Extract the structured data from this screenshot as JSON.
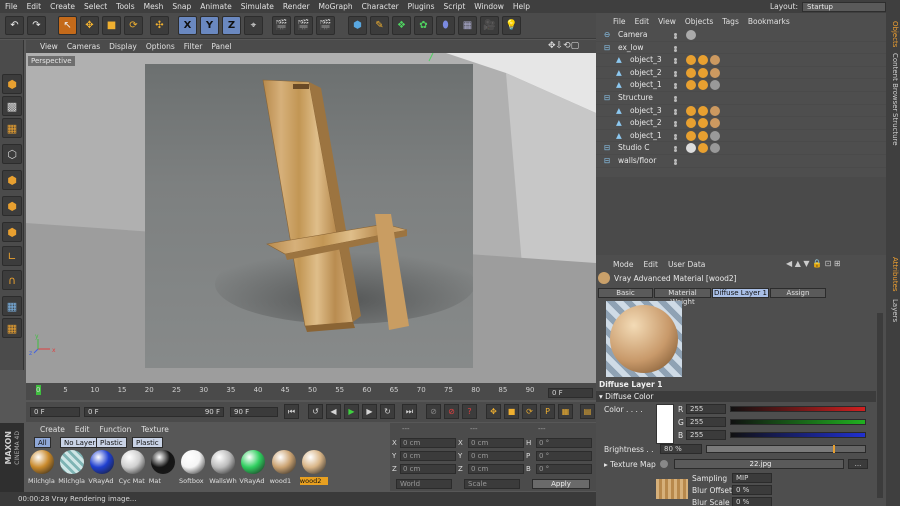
{
  "menubar": {
    "items": [
      "File",
      "Edit",
      "Create",
      "Select",
      "Tools",
      "Mesh",
      "Snap",
      "Animate",
      "Simulate",
      "Render",
      "MoGraph",
      "Character",
      "Plugins",
      "Script",
      "Window",
      "Help"
    ]
  },
  "layout": {
    "label": "Layout:",
    "value": "Startup"
  },
  "viewport": {
    "menu": [
      "View",
      "Cameras",
      "Display",
      "Options",
      "Filter",
      "Panel"
    ],
    "label": "Perspective"
  },
  "timeline": {
    "ticks": [
      "0",
      "5",
      "10",
      "15",
      "20",
      "25",
      "30",
      "35",
      "40",
      "45",
      "50",
      "55",
      "60",
      "65",
      "70",
      "75",
      "80",
      "85",
      "90"
    ],
    "end_field": "0 F",
    "current_frame": 0
  },
  "playback": {
    "start": "0 F",
    "min": "0 F",
    "max": "90 F",
    "end": "90 F"
  },
  "materials": {
    "menu": [
      "Create",
      "Edit",
      "Function",
      "Texture"
    ],
    "filters": [
      "All",
      "No Layer",
      "Plastic",
      "Plastic"
    ],
    "items": [
      {
        "name": "Milchgla",
        "color": "#c98a2c"
      },
      {
        "name": "Milchgla",
        "color": "#9fc9c9"
      },
      {
        "name": "VRayAd",
        "color": "#1f3fd0"
      },
      {
        "name": "Cyc Mat",
        "color": "#d0d0d0"
      },
      {
        "name": "Mat",
        "color": "#151515"
      },
      {
        "name": "Softbox",
        "color": "#f4f4f4"
      },
      {
        "name": "WallsWh",
        "color": "#bdbdbd"
      },
      {
        "name": "VRayAd",
        "color": "#2fcf5f"
      },
      {
        "name": "wood1",
        "color": "#cba372"
      },
      {
        "name": "wood2",
        "color": "#d9b587"
      }
    ]
  },
  "coords": {
    "headers": [
      "---",
      "---",
      "---"
    ],
    "rows": [
      {
        "a": "X",
        "av": "0 cm",
        "b": "X",
        "bv": "0 cm",
        "c": "H",
        "cv": "0 °"
      },
      {
        "a": "Y",
        "av": "0 cm",
        "b": "Y",
        "bv": "0 cm",
        "c": "P",
        "cv": "0 °"
      },
      {
        "a": "Z",
        "av": "0 cm",
        "b": "Z",
        "bv": "0 cm",
        "c": "B",
        "cv": "0 °"
      }
    ],
    "world": "World",
    "scale": "Scale",
    "apply": "Apply"
  },
  "status": {
    "text": "00:00:28 Vray Rendering image..."
  },
  "maxon": {
    "line1": "MAXON",
    "line2": "CINEMA 4D"
  },
  "objects": {
    "menu": [
      "File",
      "Edit",
      "View",
      "Objects",
      "Tags",
      "Bookmarks"
    ],
    "rows": [
      {
        "name": "Camera",
        "indent": 0
      },
      {
        "name": "ex_low",
        "indent": 0
      },
      {
        "name": "object_3",
        "indent": 1
      },
      {
        "name": "object_2",
        "indent": 1
      },
      {
        "name": "object_1",
        "indent": 1
      },
      {
        "name": "Structure",
        "indent": 0
      },
      {
        "name": "object_3",
        "indent": 1
      },
      {
        "name": "object_2",
        "indent": 1
      },
      {
        "name": "object_1",
        "indent": 1
      },
      {
        "name": "Studio C",
        "indent": 0
      },
      {
        "name": "walls/floor",
        "indent": 0
      }
    ]
  },
  "attributes": {
    "menu": [
      "Mode",
      "Edit",
      "User Data"
    ],
    "material_title": "Vray Advanced Material [wood2]",
    "tabs": [
      "Basic",
      "Material Weight",
      "Diffuse Layer 1",
      "Assign"
    ],
    "active_tab": "Diffuse Layer 1",
    "section_title": "Diffuse Layer 1",
    "subsection": "Diffuse Color",
    "color_label": "Color . . . .",
    "rgb": [
      {
        "ch": "R",
        "val": "255",
        "color": "#d02020"
      },
      {
        "ch": "G",
        "val": "255",
        "color": "#20b020"
      },
      {
        "ch": "B",
        "val": "255",
        "color": "#2030d0"
      }
    ],
    "brightness_label": "Brightness . .",
    "brightness_value": "80 %",
    "brightness_level": 0.8,
    "texture_label": "Texture Map",
    "texture_file": "22.jpg",
    "sampling_label": "Sampling",
    "sampling_value": "MIP",
    "blur_offset_label": "Blur Offset",
    "blur_offset_value": "0 %",
    "blur_scale_label": "Blur Scale",
    "blur_scale_value": "0 %"
  },
  "side_tabs": [
    "Objects",
    "Content Browser",
    "Structure",
    "Attributes",
    "Layers"
  ]
}
